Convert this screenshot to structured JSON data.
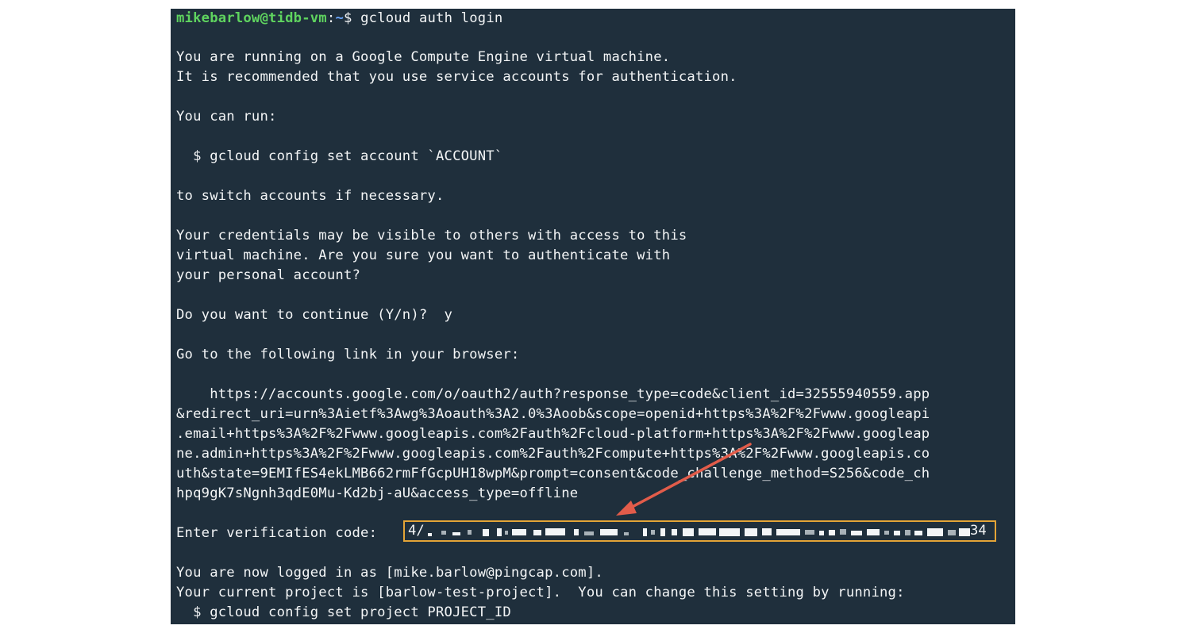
{
  "terminal": {
    "prompt": {
      "user_host": "mikebarlow@tidb-vm",
      "separator": ":",
      "path": "~",
      "dollar": "$",
      "command": " gcloud auth login"
    },
    "lines": [
      "You are running on a Google Compute Engine virtual machine.",
      "It is recommended that you use service accounts for authentication.",
      "You can run:",
      "  $ gcloud config set account `ACCOUNT`",
      "to switch accounts if necessary.",
      "Your credentials may be visible to others with access to this",
      "virtual machine. Are you sure you want to authenticate with",
      "your personal account?",
      "Do you want to continue (Y/n)?  y",
      "Go to the following link in your browser:",
      "    https://accounts.google.com/o/oauth2/auth?response_type=code&client_id=32555940559.app",
      "&redirect_uri=urn%3Aietf%3Awg%3Aoauth%3A2.0%3Aoob&scope=openid+https%3A%2F%2Fwww.googleapi",
      ".email+https%3A%2F%2Fwww.googleapis.com%2Fauth%2Fcloud-platform+https%3A%2F%2Fwww.googleap",
      "ne.admin+https%3A%2F%2Fwww.googleapis.com%2Fauth%2Fcompute+https%3A%2F%2Fwww.googleapis.co",
      "uth&state=9EMIfES4ekLMB662rmFfGcpUH18wpM&prompt=consent&code_challenge_method=S256&code_ch",
      "hpq9gK7sNgnh3qdE0Mu-Kd2bj-aU&access_type=offline",
      "Enter verification code: ",
      "You are now logged in as [mike.barlow@pingcap.com].",
      "Your current project is [barlow-test-project].  You can change this setting by running:",
      "  $ gcloud config set project PROJECT_ID"
    ],
    "verification_code": {
      "prefix": "4/",
      "suffix": "34"
    }
  },
  "colors": {
    "terminal_bg": "#1f2f3c",
    "text": "#f3f5f6",
    "prompt_user": "#5fd45f",
    "prompt_path": "#6aa7ff",
    "highlight_box": "#e3a437",
    "arrow": "#e25c4a"
  }
}
